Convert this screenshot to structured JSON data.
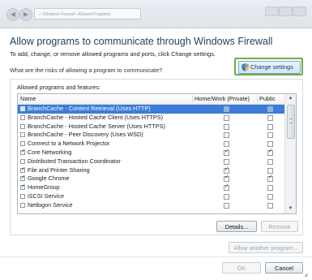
{
  "titlebar": {
    "address": "‹ ‹ Windows Firewall › Allowed Programs",
    "back_icon": "back-arrow-icon",
    "forward_icon": "forward-arrow-icon"
  },
  "header": {
    "title": "Allow programs to communicate through Windows Firewall",
    "subtitle": "To add, change, or remove allowed programs and ports, click Change settings.",
    "risk_link": "What are the risks of allowing a program to communicate?",
    "change_settings_label": "Change settings",
    "highlight_color": "#6bb044"
  },
  "group": {
    "legend": "Allowed programs and features:",
    "columns": {
      "name": "Name",
      "home": "Home/Work (Private)",
      "public": "Public"
    },
    "rows": [
      {
        "name": "BranchCache - Content Retrieval (Uses HTTP)",
        "enabled": false,
        "home": false,
        "public": false,
        "selected": true
      },
      {
        "name": "BranchCache - Hosted Cache Client (Uses HTTPS)",
        "enabled": false,
        "home": false,
        "public": false,
        "selected": false
      },
      {
        "name": "BranchCache - Hosted Cache Server (Uses HTTPS)",
        "enabled": false,
        "home": false,
        "public": false,
        "selected": false
      },
      {
        "name": "BranchCache - Peer Discovery (Uses WSD)",
        "enabled": false,
        "home": false,
        "public": false,
        "selected": false
      },
      {
        "name": "Connect to a Network Projector",
        "enabled": false,
        "home": false,
        "public": false,
        "selected": false
      },
      {
        "name": "Core Networking",
        "enabled": true,
        "home": true,
        "public": true,
        "selected": false
      },
      {
        "name": "Distributed Transaction Coordinator",
        "enabled": false,
        "home": false,
        "public": false,
        "selected": false
      },
      {
        "name": "File and Printer Sharing",
        "enabled": true,
        "home": true,
        "public": false,
        "selected": false
      },
      {
        "name": "Google Chrome",
        "enabled": true,
        "home": true,
        "public": true,
        "selected": false
      },
      {
        "name": "HomeGroup",
        "enabled": true,
        "home": true,
        "public": false,
        "selected": false
      },
      {
        "name": "iSCSI Service",
        "enabled": false,
        "home": false,
        "public": false,
        "selected": false
      },
      {
        "name": "Netlogon Service",
        "enabled": false,
        "home": false,
        "public": false,
        "selected": false
      }
    ],
    "details_label": "Details...",
    "remove_label": "Remove"
  },
  "footer": {
    "allow_another_label": "Allow another program...",
    "ok_label": "OK",
    "cancel_label": "Cancel"
  }
}
